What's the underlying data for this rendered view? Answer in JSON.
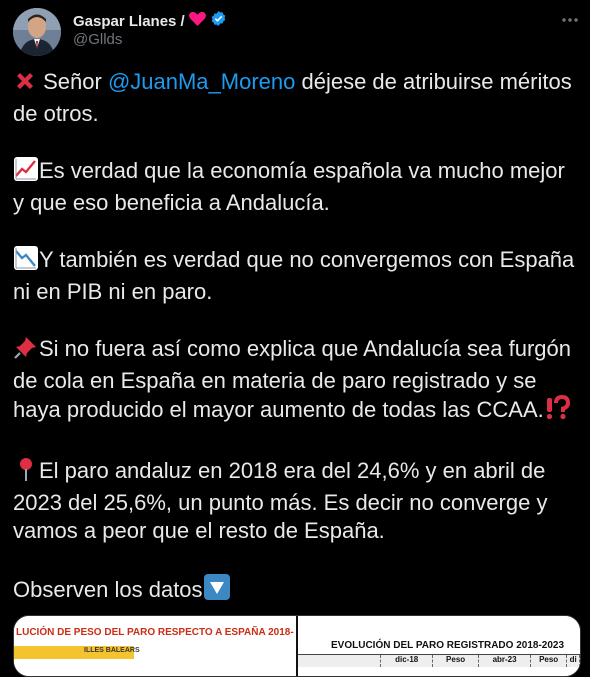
{
  "author": {
    "name": "Gaspar Llanes /",
    "name_emoji": "heart-emoji",
    "handle": "@Gllds",
    "verified": true
  },
  "tweet": {
    "p1_prefix": " Señor ",
    "p1_mention": "@JuanMa_Moreno",
    "p1_suffix": " déjese de atribuirse méritos de otros.",
    "p2": "Es verdad que la economía española va mucho mejor y que eso beneficia a Andalucía.",
    "p3": "Y también es verdad que no convergemos con España ni en PIB ni en paro.",
    "p4": "Si no fuera así como explica que Andalucía sea furgón de cola en España en materia de paro registrado y se haya producido el mayor aumento de todas las CCAA.",
    "p5": "El paro andaluz en 2018 era del 24,6% y en abril de 2023 del 25,6%, un punto más. Es decir no converge y vamos a peor que el resto de España.",
    "p6": "Observen los datos"
  },
  "media": {
    "left_title": "LUCIÓN DE PESO DEL PARO RESPECTO A ESPAÑA 2018-",
    "left_label": "ILLES BALEARS",
    "right_title": "EVOLUCIÓN DEL PARO REGISTRADO 2018-2023",
    "right_headers": [
      "",
      "dic-18",
      "Peso",
      "abr-23",
      "Peso",
      "di"
    ]
  },
  "colors": {
    "background": "#000000",
    "text": "#e7e9ea",
    "secondary": "#71767b",
    "accent": "#1d9bf0"
  }
}
